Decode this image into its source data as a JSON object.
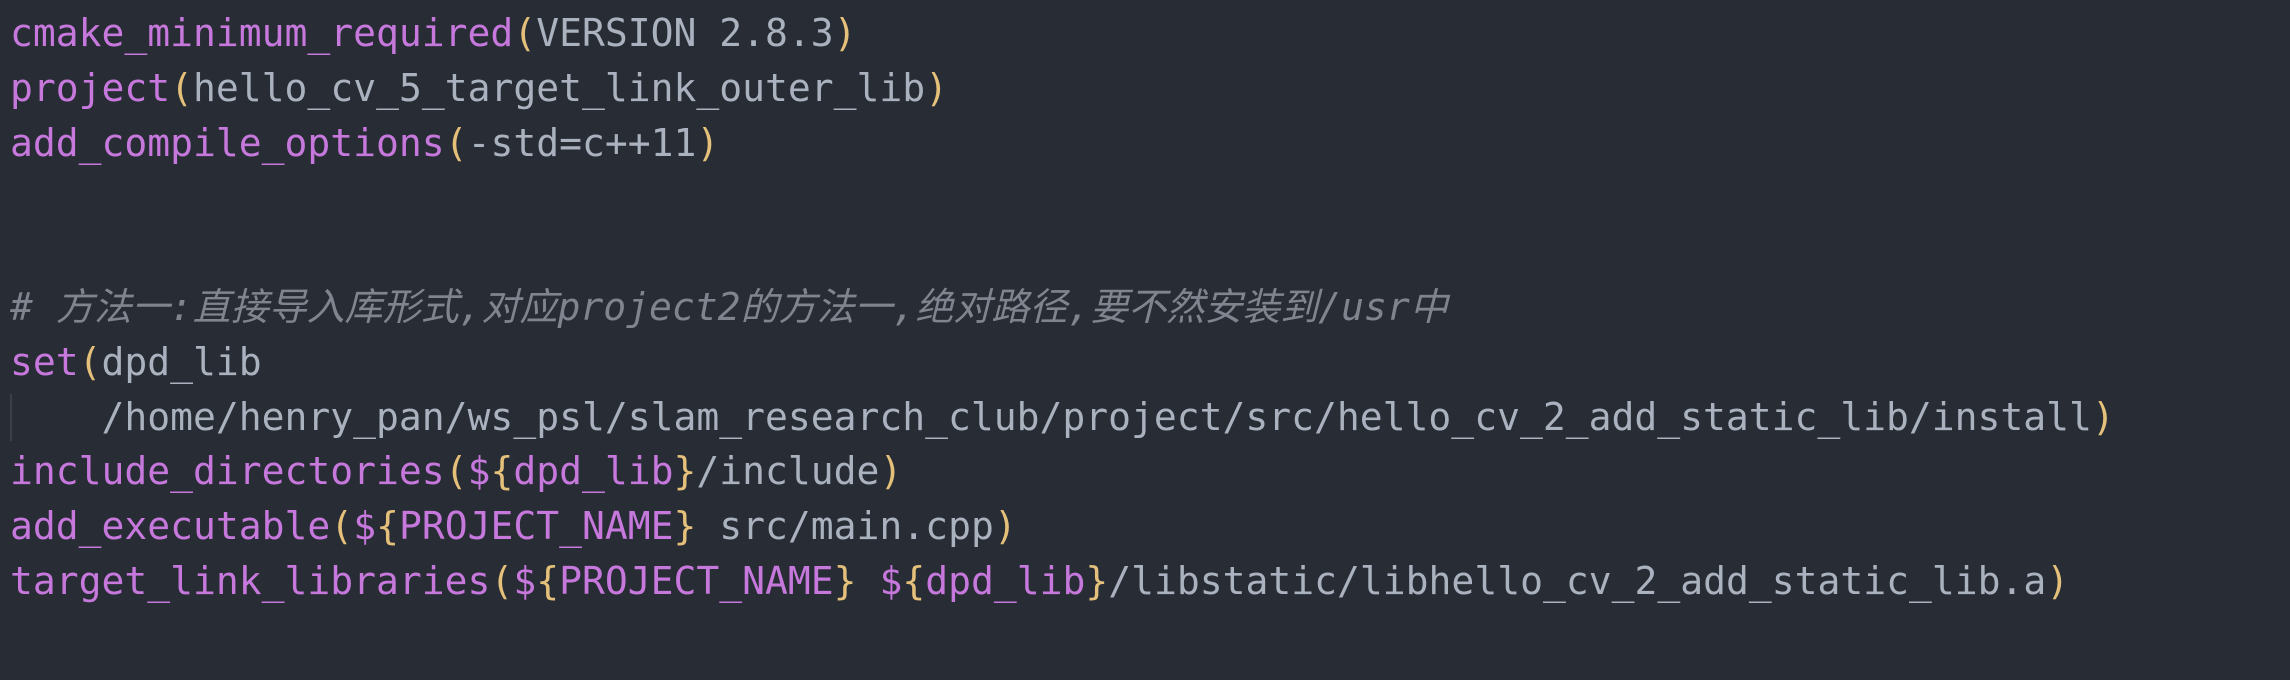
{
  "editor": {
    "background": "#282c34",
    "colors": {
      "function": "#c678dd",
      "paren": "#e5c07b",
      "text": "#abb2bf",
      "comment": "#7f848e"
    },
    "lines": [
      {
        "fn": "cmake_minimum_required",
        "open": "(",
        "arg": "VERSION 2.8.3",
        "close": ")"
      },
      {
        "fn": "project",
        "open": "(",
        "arg": "hello_cv_5_target_link_outer_lib",
        "close": ")"
      },
      {
        "fn": "add_compile_options",
        "open": "(",
        "arg": "-std=c++11",
        "close": ")"
      },
      {
        "comment": "# 方法一:直接导入库形式,对应project2的方法一,绝对路径,要不然安装到/usr中"
      },
      {
        "fn": "set",
        "open": "(",
        "arg": "dpd_lib"
      },
      {
        "arg": "    /home/henry_pan/ws_psl/slam_research_club/project/src/hello_cv_2_add_static_lib/install",
        "close": ")"
      },
      {
        "fn": "include_directories",
        "open": "(",
        "dollar": "$",
        "lbrace": "{",
        "var": "dpd_lib",
        "rbrace": "}",
        "arg": "/include",
        "close": ")"
      },
      {
        "fn": "add_executable",
        "open": "(",
        "dollar": "$",
        "lbrace": "{",
        "var": "PROJECT_NAME",
        "rbrace": "}",
        "arg": " src/main.cpp",
        "close": ")"
      },
      {
        "fn": "target_link_libraries",
        "open": "(",
        "dollar": "$",
        "lbrace": "{",
        "var": "PROJECT_NAME",
        "rbrace": "}",
        "space": " ",
        "dollar2": "$",
        "lbrace2": "{",
        "var2": "dpd_lib",
        "rbrace2": "}",
        "arg": "/libstatic/libhello_cv_2_add_static_lib.a",
        "close": ")"
      }
    ]
  }
}
